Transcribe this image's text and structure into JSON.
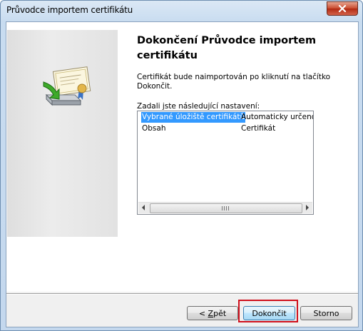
{
  "window": {
    "title": "Průvodce importem certifikátu"
  },
  "wizard": {
    "heading_line1": "Dokončení Průvodce importem",
    "heading_line2": "certifikátu",
    "info_line1": "Certifikát bude naimportován po kliknutí na tlačítko",
    "info_line2": "Dokončit.",
    "settings_label": "Zadali jste následující nastavení:",
    "settings": [
      {
        "name": "Vybrané úložiště certifikátů",
        "value": "Automaticky určeno průvodc"
      },
      {
        "name": "Obsah",
        "value": "Certifikát"
      }
    ]
  },
  "buttons": {
    "back_prefix": "< ",
    "back_mnemonic": "Z",
    "back_rest": "pět",
    "finish_label": "Dokončit",
    "cancel_label": "Storno"
  },
  "icons": {
    "close": "close-icon",
    "wizard_art": "certificate-import-icon",
    "scroll_left": "scroll-left-arrow-icon",
    "scroll_right": "scroll-right-arrow-icon"
  },
  "colors": {
    "selection": "#3399ff",
    "highlight_box": "#d0101c",
    "close_button": "#c94a2c"
  }
}
